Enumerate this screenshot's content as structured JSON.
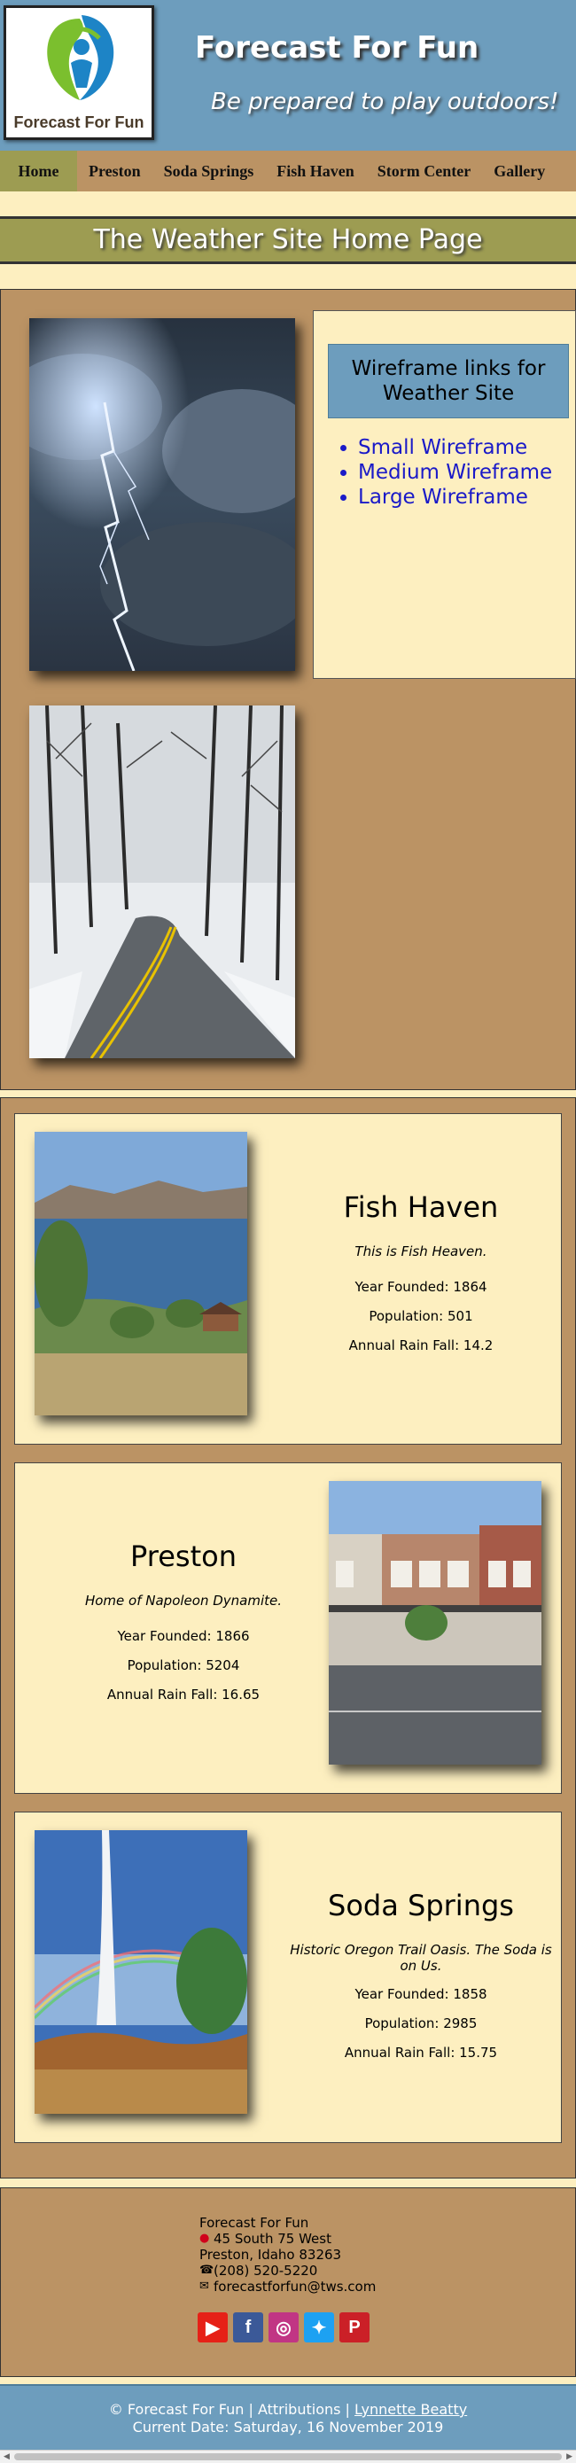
{
  "header": {
    "logo_text": "Forecast For Fun",
    "site_title": "Forecast For Fun",
    "tagline": "Be prepared to play outdoors!"
  },
  "nav": {
    "items": [
      {
        "label": "Home"
      },
      {
        "label": "Preston"
      },
      {
        "label": "Soda Springs"
      },
      {
        "label": "Fish Haven"
      },
      {
        "label": "Storm Center"
      },
      {
        "label": "Gallery"
      }
    ]
  },
  "page_heading": "The Weather Site Home Page",
  "wireframes": {
    "title": "Wireframe links for Weather Site",
    "links": [
      {
        "label": "Small Wireframe"
      },
      {
        "label": "Medium Wireframe"
      },
      {
        "label": "Large Wireframe"
      }
    ]
  },
  "towns": [
    {
      "name": "Fish Haven",
      "tagline": "This is Fish Heaven.",
      "year_founded": "Year Founded: 1864",
      "population": "Population: 501",
      "rainfall": "Annual Rain Fall: 14.2"
    },
    {
      "name": "Preston",
      "tagline": "Home of Napoleon Dynamite.",
      "year_founded": "Year Founded: 1866",
      "population": "Population: 5204",
      "rainfall": "Annual Rain Fall: 16.65"
    },
    {
      "name": "Soda Springs",
      "tagline": "Historic Oregon Trail Oasis. The Soda is on Us.",
      "year_founded": "Year Founded: 1858",
      "population": "Population: 2985",
      "rainfall": "Annual Rain Fall: 15.75"
    }
  ],
  "contact": {
    "name": "Forecast For Fun",
    "street": "45 South 75 West",
    "city": "Preston, Idaho 83263",
    "phone": "(208) 520-5220",
    "email": "forecastforfun@tws.com",
    "location_icon": "map-pin-icon",
    "phone_icon": "phone-icon",
    "email_icon": "envelope-icon"
  },
  "social": [
    {
      "name": "youtube-icon",
      "glyph": "▶",
      "color": "#e62117"
    },
    {
      "name": "facebook-icon",
      "glyph": "f",
      "color": "#3b5998"
    },
    {
      "name": "instagram-icon",
      "glyph": "◎",
      "color": "#c13584"
    },
    {
      "name": "twitter-icon",
      "glyph": "✦",
      "color": "#1da1f2"
    },
    {
      "name": "pinterest-icon",
      "glyph": "P",
      "color": "#cb2027"
    }
  ],
  "footer": {
    "copyright": "© Forecast For Fun | Attributions |",
    "author": "Lynnette Beatty",
    "current_date": "Current Date: Saturday, 16 November 2019"
  },
  "colors": {
    "cream": "#fdefc0",
    "tan": "#bb9364",
    "blue": "#6d9dbd",
    "olive": "#9d9c52",
    "link": "#1a1ac8"
  }
}
